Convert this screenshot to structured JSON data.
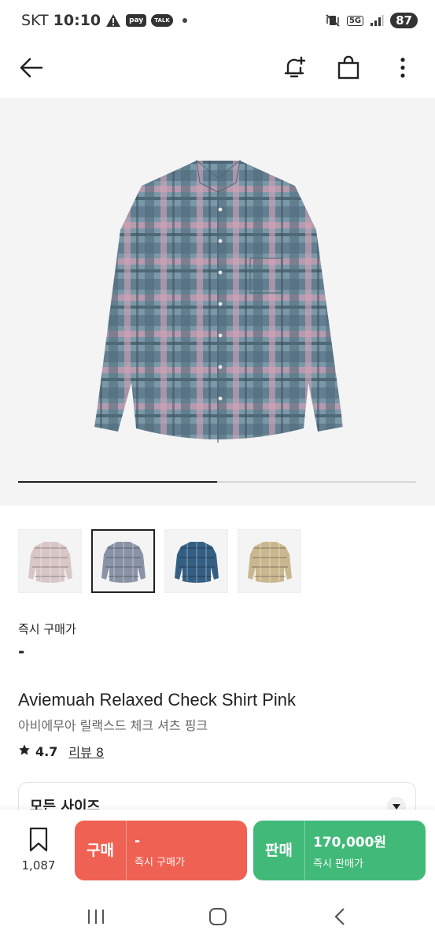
{
  "status_bar": {
    "carrier": "SKT",
    "time": "10:10",
    "pay_badge": "pay",
    "talk_badge": "TALK",
    "network": "5G",
    "battery": "87"
  },
  "header": {
    "icons": [
      "back-arrow-icon",
      "notification-add-icon",
      "shopping-bag-icon",
      "more-vertical-icon"
    ]
  },
  "gallery": {
    "progress": 0.5
  },
  "thumbnails": [
    {
      "color": "#d9c7c8",
      "active": false
    },
    {
      "color": "#8a93a6",
      "active": true
    },
    {
      "color": "#345f83",
      "active": false
    },
    {
      "color": "#c9b88f",
      "active": false
    }
  ],
  "price": {
    "label": "즉시 구매가",
    "value": "-"
  },
  "product": {
    "title_en": "Aviemuah Relaxed Check Shirt Pink",
    "title_ko": "아비에무아 릴랙스드 체크 셔츠 핑크",
    "rating": "4.7",
    "reviews": "리뷰 8"
  },
  "size_select": {
    "label": "모든 사이즈"
  },
  "bottom_bar": {
    "wish_count": "1,087",
    "buy": {
      "label": "구매",
      "price": "-",
      "caption": "즉시 구매가"
    },
    "sell": {
      "label": "판매",
      "price": "170,000원",
      "caption": "즉시 판매가"
    }
  },
  "colors": {
    "buy": "#ef6253",
    "sell": "#41b979"
  }
}
